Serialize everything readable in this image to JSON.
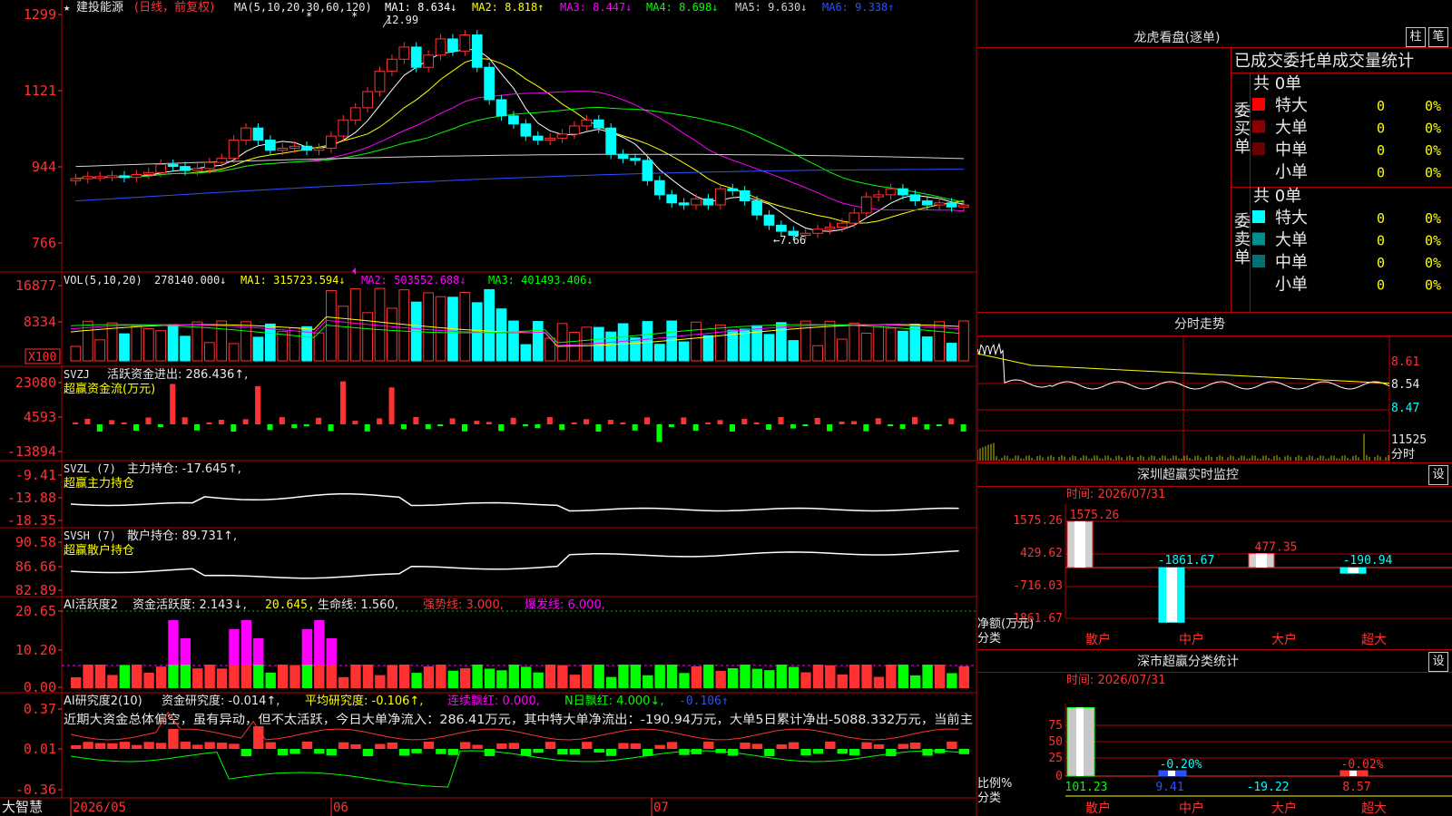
{
  "stock": {
    "name": "建投能源",
    "mode": "(日线，前复权)"
  },
  "ma_legend": {
    "label": "MA(5,10,20,30,60,120)",
    "items": [
      {
        "text": "MA1: 8.634↓",
        "color": "#ffffff"
      },
      {
        "text": "MA2: 8.818↑",
        "color": "#ffff00"
      },
      {
        "text": "MA3: 8.447↓",
        "color": "#ff00ff"
      },
      {
        "text": "MA4: 8.698↓",
        "color": "#00ff00"
      },
      {
        "text": "MA5: 9.630↓",
        "color": "#d0d0d0"
      },
      {
        "text": "MA6: 9.338↑",
        "color": "#2a50ff"
      }
    ]
  },
  "price_axis": [
    "1299",
    "1121",
    "944",
    "766"
  ],
  "annotations": {
    "high": "12.99",
    "low": "←7.66"
  },
  "vol": {
    "label": "VOL(5,10,20)",
    "value": "278140.000↓",
    "ma1": "MA1: 315723.594↓",
    "ma2": "MA2: 503552.688↓",
    "ma3": "MA3: 401493.406↓",
    "axis": [
      "16877",
      "8334",
      "X100"
    ]
  },
  "svzj": {
    "label": "SVZJ",
    "name": "活跃资金进出: 286.436↑,",
    "sub": "超赢资金流(万元)",
    "axis": [
      "23080",
      "4593",
      "-13894"
    ]
  },
  "svzl": {
    "label": "SVZL (7)",
    "name": "主力持仓: -17.645↑,",
    "sub": "超赢主力持仓",
    "axis": [
      "-9.41",
      "-13.88",
      "-18.35"
    ]
  },
  "svsh": {
    "label": "SVSH (7)",
    "name": "散户持仓: 89.731↑,",
    "sub": "超赢散户持仓",
    "axis": [
      "90.58",
      "86.66",
      "82.89"
    ]
  },
  "ai_active": {
    "label": "AI活跃度2",
    "v1": "资金活跃度: 2.143↓,",
    "v2": "20.645,",
    "v3": "生命线: 1.560,",
    "v4": "强势线: 3.000,",
    "v5": "爆发线: 6.000,",
    "axis": [
      "20.65",
      "10.20",
      "0.00"
    ]
  },
  "ai_research": {
    "label": "AI研究度2(10)",
    "v1": "资金研究度: -0.014↑,",
    "v2": "平均研究度: -0.106↑,",
    "v3": "连续飘红: 0.000,",
    "v4": "N日飘红: 4.000↓,",
    "v5": "-0.106↑",
    "axis": [
      "0.37",
      "0.01",
      "-0.36"
    ],
    "commentary": "近期大资金总体偏空，虽有异动，但不太活跃，今日大单净流入：286.41万元，其中特大单净流出：-190.94万元，大单5日累计净出-5088.332万元，当前主"
  },
  "date_axis": {
    "brand": "大智慧",
    "labels": [
      "2026/05",
      "06",
      "07"
    ]
  },
  "colors": {
    "up": "#ff3232",
    "down": "#00ffff",
    "grid": "#b40000",
    "yellow": "#ffff00"
  },
  "longhu": {
    "title": "龙虎看盘(逐单)",
    "btn_zhu": "柱",
    "btn_bi": "笔",
    "header": "已成交委托单成交量统计",
    "buy": {
      "side": "委买单",
      "total": "共 0单",
      "rows": [
        {
          "label": "特大",
          "count": "0",
          "pct": "0%",
          "color": "#ff0000"
        },
        {
          "label": "大单",
          "count": "0",
          "pct": "0%",
          "color": "#8b0000"
        },
        {
          "label": "中单",
          "count": "0",
          "pct": "0%",
          "color": "#6b0000"
        },
        {
          "label": "小单",
          "count": "0",
          "pct": "0%",
          "color": ""
        }
      ]
    },
    "sell": {
      "side": "委卖单",
      "total": "共 0单",
      "rows": [
        {
          "label": "特大",
          "count": "0",
          "pct": "0%",
          "color": "#00ffff"
        },
        {
          "label": "大单",
          "count": "0",
          "pct": "0%",
          "color": "#009090"
        },
        {
          "label": "中单",
          "count": "0",
          "pct": "0%",
          "color": "#007070"
        },
        {
          "label": "小单",
          "count": "0",
          "pct": "0%",
          "color": ""
        }
      ]
    }
  },
  "intraday": {
    "title": "分时走势",
    "axis": [
      "8.61",
      "8.54",
      "8.47"
    ],
    "vol_label": "11525",
    "vol_unit": "分时"
  },
  "monitor": {
    "title": "深圳超赢实时监控",
    "btn": "设",
    "time": "时间: 2026/07/31",
    "axis": [
      "1575.26",
      "429.62",
      "-716.03",
      "-1861.67"
    ],
    "ylabel": "净额(万元)",
    "xlabel": "分类",
    "categories": [
      "散户",
      "中户",
      "大户",
      "超大"
    ],
    "value_labels": [
      "1575.26",
      "-1861.67",
      "477.35",
      "-190.94"
    ]
  },
  "classify": {
    "title": "深市超赢分类统计",
    "btn": "设",
    "time": "时间: 2026/07/31",
    "axis": [
      "75",
      "50",
      "25",
      "0"
    ],
    "ylabel": "比例%",
    "xlabel": "分类",
    "categories": [
      "散户",
      "中户",
      "大户",
      "超大"
    ],
    "pct_labels": [
      "",
      "-0.20%",
      "",
      "-0.02%"
    ],
    "values_text": [
      "101.23",
      "9.41",
      "-19.22",
      "8.57"
    ]
  }
}
